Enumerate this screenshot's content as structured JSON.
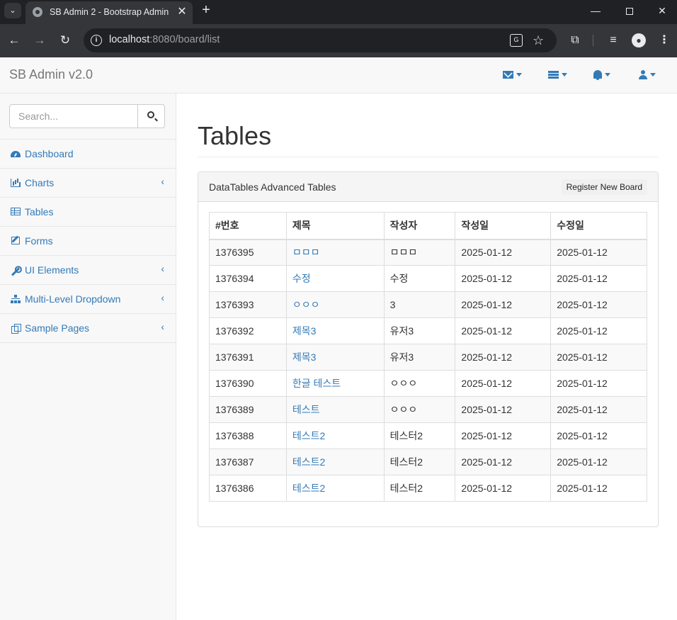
{
  "browser": {
    "tab_title": "SB Admin 2 - Bootstrap Admin",
    "url_host": "localhost",
    "url_path": ":8080/board/list",
    "new_tab_label": "+",
    "close_label": "✕"
  },
  "navbar": {
    "brand": "SB Admin v2.0",
    "dropdowns": [
      {
        "icon": "envelope-icon"
      },
      {
        "icon": "tasks-icon"
      },
      {
        "icon": "bell-icon"
      },
      {
        "icon": "user-icon"
      }
    ]
  },
  "sidebar": {
    "search_placeholder": "Search...",
    "items": [
      {
        "label": "Dashboard",
        "icon": "dashboard-icon",
        "has_arrow": false
      },
      {
        "label": "Charts",
        "icon": "bar-chart-icon",
        "has_arrow": true
      },
      {
        "label": "Tables",
        "icon": "table-icon",
        "has_arrow": false
      },
      {
        "label": "Forms",
        "icon": "edit-icon",
        "has_arrow": false
      },
      {
        "label": "UI Elements",
        "icon": "wrench-icon",
        "has_arrow": true
      },
      {
        "label": "Multi-Level Dropdown",
        "icon": "sitemap-icon",
        "has_arrow": true
      },
      {
        "label": "Sample Pages",
        "icon": "files-icon",
        "has_arrow": true
      }
    ],
    "arrow_glyph": "‹"
  },
  "main": {
    "page_title": "Tables",
    "panel_title": "DataTables Advanced Tables",
    "register_button": "Register New Board",
    "table": {
      "headers": [
        "#번호",
        "제목",
        "작성자",
        "작성일",
        "수정일"
      ],
      "rows": [
        [
          "1376395",
          "ㅁㅁㅁ",
          "ㅁㅁㅁ",
          "2025-01-12",
          "2025-01-12"
        ],
        [
          "1376394",
          "수정",
          "수정",
          "2025-01-12",
          "2025-01-12"
        ],
        [
          "1376393",
          "ㅇㅇㅇ",
          "3",
          "2025-01-12",
          "2025-01-12"
        ],
        [
          "1376392",
          "제목3",
          "유저3",
          "2025-01-12",
          "2025-01-12"
        ],
        [
          "1376391",
          "제목3",
          "유저3",
          "2025-01-12",
          "2025-01-12"
        ],
        [
          "1376390",
          "한글 테스트",
          "ㅇㅇㅇ",
          "2025-01-12",
          "2025-01-12"
        ],
        [
          "1376389",
          "테스트",
          "ㅇㅇㅇ",
          "2025-01-12",
          "2025-01-12"
        ],
        [
          "1376388",
          "테스트2",
          "테스터2",
          "2025-01-12",
          "2025-01-12"
        ],
        [
          "1376387",
          "테스트2",
          "테스터2",
          "2025-01-12",
          "2025-01-12"
        ],
        [
          "1376386",
          "테스트2",
          "테스터2",
          "2025-01-12",
          "2025-01-12"
        ]
      ]
    }
  },
  "colors": {
    "link": "#337ab7",
    "chrome_dark": "#202124",
    "chrome_toolbar": "#35363a",
    "navbar_bg": "#f8f8f8"
  }
}
